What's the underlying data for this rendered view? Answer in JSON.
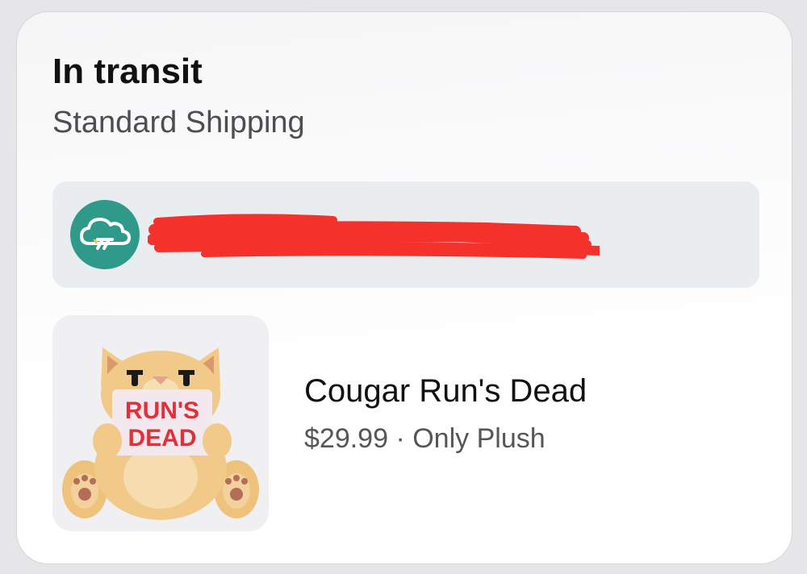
{
  "order": {
    "status": "In transit",
    "shipping_method": "Standard Shipping"
  },
  "carrier": {
    "icon": "cloud-truck-icon",
    "tracking_info_redacted": true
  },
  "product": {
    "name": "Cougar Run's Dead",
    "price": "$29.99",
    "separator": "·",
    "seller": "Only Plush",
    "image_sign_text_line1": "RUN'S",
    "image_sign_text_line2": "DEAD"
  },
  "colors": {
    "carrier_logo": "#2f9a8a",
    "redaction": "#f4312b",
    "plush_body": "#f1c988",
    "sign_text": "#e0303a"
  }
}
